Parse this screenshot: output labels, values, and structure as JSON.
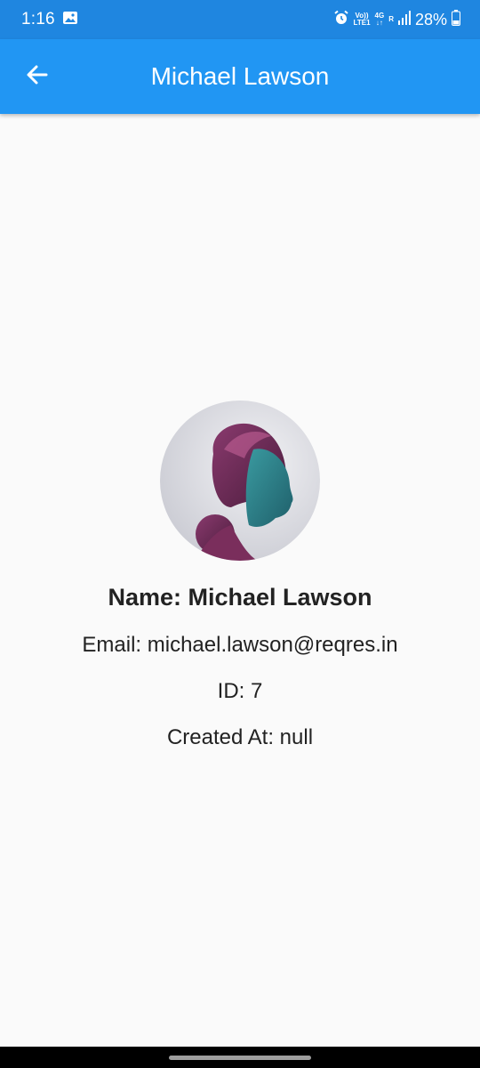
{
  "status_bar": {
    "time": "1:16",
    "volte_top": "Vo))",
    "volte_bottom": "LTE1",
    "network_top": "4G",
    "network_bottom": "↓↑",
    "roaming": "R",
    "battery_percent": "28%",
    "icons": [
      "gallery-icon",
      "alarm-icon",
      "signal-icon",
      "battery-icon"
    ]
  },
  "app_bar": {
    "title": "Michael Lawson",
    "back_icon": "arrow-back-icon"
  },
  "profile": {
    "name": "Name: Michael Lawson",
    "email": "Email: michael.lawson@reqres.in",
    "id": "ID: 7",
    "created_at": "Created At: null"
  },
  "colors": {
    "status_bar": "#1f86e0",
    "app_bar": "#2196f3",
    "background": "#fafafa",
    "text": "#222222"
  }
}
